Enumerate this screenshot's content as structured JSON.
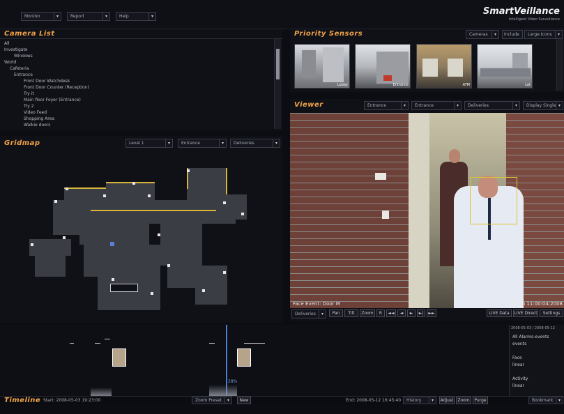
{
  "brand": {
    "name": "SmartVeillance",
    "tagline": "Intelligent Video Surveillance"
  },
  "top_menus": [
    {
      "label": "Monitor"
    },
    {
      "label": "Report"
    },
    {
      "label": "Help"
    }
  ],
  "camera_list": {
    "title": "Camera List",
    "items": [
      "All",
      "Investigate",
      "Windows",
      "World",
      "Cafeteria",
      "Entrance",
      "Front Door Watchdesk",
      "Front Door Counter (Reception)",
      "Try it",
      "Main floor Foyer (Entrance)",
      "Try 2",
      "Video Feed",
      "Shopping Area",
      "Walkie doors"
    ]
  },
  "gridmap": {
    "title": "Gridmap",
    "dropdowns": [
      "Level 1",
      "Entrance",
      "Deliveries"
    ]
  },
  "priority_sensors": {
    "title": "Priority Sensors",
    "controls": [
      "Cameras",
      "Include",
      "Large Icons"
    ],
    "thumbnails": [
      {
        "label": "Lobby"
      },
      {
        "label": "Entrance"
      },
      {
        "label": "ATM"
      },
      {
        "label": "Lot"
      }
    ]
  },
  "viewer": {
    "title": "Viewer",
    "dropdowns": [
      "Entrance",
      "Entrance",
      "Deliveries",
      "Display Single"
    ],
    "overlay_left": "Face Event: Door M",
    "overlay_right": "Door Cam 11:00:04:2008",
    "bottom_controls": {
      "select": "Deliveries",
      "buttons": [
        "Pan",
        "Tilt",
        "Zoom",
        "R",
        "◄◄",
        "◄",
        "►",
        "►|",
        "►►"
      ],
      "right_buttons": [
        "LIVE Data",
        "LIVE Direct",
        "Settings"
      ]
    }
  },
  "timeline": {
    "title": "Timeline",
    "start": "Start: 2008-05-03 19:23:00",
    "end": "End: 2008-05-12 16:45:40",
    "zoom_select": "Zoom Preset",
    "new_label": "New",
    "history_select": "History",
    "action_buttons": [
      "Adjust",
      "Zoom",
      "Purge"
    ],
    "bookmark_select": "Bookmark",
    "marker_pct": "28%",
    "side_panel": {
      "header": "2008-05-03 / 2008-05-12",
      "groups": [
        {
          "label": "All Alarms-events",
          "value": "events"
        },
        {
          "label": "Face",
          "value": "linear"
        },
        {
          "label": "Activity",
          "value": "linear"
        }
      ]
    }
  }
}
